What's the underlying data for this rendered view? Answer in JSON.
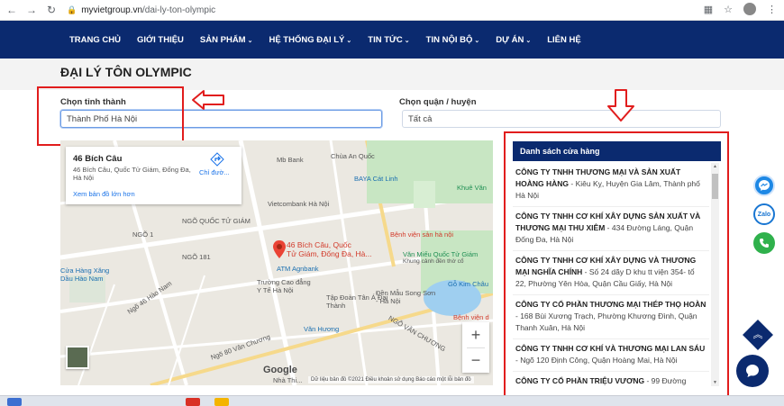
{
  "browser": {
    "url_domain": "myvietgroup.vn",
    "url_path": "/dai-ly-ton-olympic",
    "back_icon": "←",
    "forward_icon": "→",
    "reload_icon": "↻"
  },
  "nav": {
    "items": [
      {
        "label": "TRANG CHỦ",
        "caret": ""
      },
      {
        "label": "GIỚI THIỆU",
        "caret": ""
      },
      {
        "label": "SẢN PHẨM",
        "caret": "⌄"
      },
      {
        "label": "HỆ THỐNG ĐẠI LÝ",
        "caret": "⌄"
      },
      {
        "label": "TIN TỨC",
        "caret": "⌄"
      },
      {
        "label": "TIN NỘI BỘ",
        "caret": "⌄"
      },
      {
        "label": "DỰ ÁN",
        "caret": "⌄"
      },
      {
        "label": "LIÊN HỆ",
        "caret": ""
      }
    ]
  },
  "page": {
    "title": "ĐẠI LÝ TÔN OLYMPIC"
  },
  "filters": {
    "province_label": "Chọn tỉnh thành",
    "province_value": "Thành Phố Hà Nội",
    "district_label": "Chọn quận / huyện",
    "district_value": "Tất cả"
  },
  "map": {
    "card_title": "46 Bích Câu",
    "card_address": "46 Bích Câu, Quốc Tử Giám, Đống Đa, Hà Nội",
    "card_link": "Xem bản đồ lớn hơn",
    "directions_label": "Chỉ đườ...",
    "pin_label_1": "46 Bích Câu, Quốc",
    "pin_label_2": "Tử Giám, Đống Đa, Hà...",
    "zoom_in": "+",
    "zoom_out": "−",
    "google_logo": "Google",
    "footer": "Dữ liệu bản đồ ©2021   Điều khoản sử dụng   Báo cáo một lỗi bản đồ",
    "labels": {
      "chua_an_quoc": "Chùa An Quốc",
      "mb_bank": "Mb Bank",
      "baya": "BAYA Cát Linh",
      "khue_van": "Khuê Văn",
      "vietcombank": "Vietcombank Hà Nội",
      "ngo_quoc_tu_giam": "NGÕ QUỐC TỬ GIÁM",
      "benh_vien_san": "Bệnh viện sản hà nội",
      "van_mieu": "Văn Miếu Quốc Tử Giám",
      "van_mieu_sub": "Khung cảnh đền thờ cổ",
      "atm": "ATM Agnbank",
      "truong_cao_dang": "Trường Cao đẳng Y Tế Hà Nội",
      "tap_doan": "Tập Đoàn Tân Á Đại Thành",
      "den_mau": "Đền Mẫu Song Sơn - Hà Nội",
      "go_kim_chau": "Gỗ Kim Châu",
      "cua_hang": "Cửa Hàng Xăng Dầu Hào Nam",
      "van_huong": "Văn Hương",
      "benh_vien_2": "Bệnh viện d",
      "ngo_46": "Ngõ 46 Hào Nam",
      "ngo_1": "NGÕ 1",
      "ngo_181": "NGÕ 181",
      "nha_thi": "Nhà Thi...",
      "ngo_80": "Ngõ 80 Vân Chương",
      "ngo_van_chuong": "NGÕ VĂN CHƯƠNG"
    }
  },
  "stores": {
    "header": "Danh sách cửa hàng",
    "items": [
      {
        "name": "CÔNG TY TNHH THƯƠNG MẠI VÀ SẢN XUẤT HOÀNG HÀNG",
        "address": " - Kiêu Kỵ, Huyện Gia Lâm, Thành phố Hà Nội"
      },
      {
        "name": "CÔNG TY TNHH CƠ KHÍ XÂY DỰNG SẢN XUẤT VÀ THƯƠNG MẠI THU XIÊM",
        "address": " - 434 Đường Láng, Quận Đống Đa, Hà Nội"
      },
      {
        "name": "CÔNG TY TNHH CƠ KHÍ XÂY DỰNG VÀ THƯƠNG MẠI NGHĨA CHÍNH",
        "address": " - Số 24 dãy D khu tt viện 354- tổ 22, Phường Yên Hòa, Quận Cầu Giấy, Hà Nội"
      },
      {
        "name": "CÔNG TY CỔ PHẦN THƯƠNG MẠI THÉP THỌ HOÀN",
        "address": " - 168 Bùi Xương Trạch, Phường Khương Đình, Quận Thanh Xuân, Hà Nội"
      },
      {
        "name": "CÔNG TY TNHH CƠ KHÍ VÀ THƯƠNG MẠI LAN SÁU",
        "address": " - Ngõ 120 Định Công, Quận Hoàng Mai, Hà Nội"
      },
      {
        "name": "CÔNG TY CỔ PHẦN TRIỆU VƯƠNG",
        "address": " - 99 Đường"
      }
    ]
  },
  "floating": {
    "zalo": "Zalo",
    "scroll_top_icon": "︽"
  },
  "colors": {
    "navy": "#0b2a6f",
    "highlight_red": "#e11d1d",
    "messenger": "#1e88e5",
    "zalo": "#1976d2",
    "phone": "#2fb14c"
  }
}
